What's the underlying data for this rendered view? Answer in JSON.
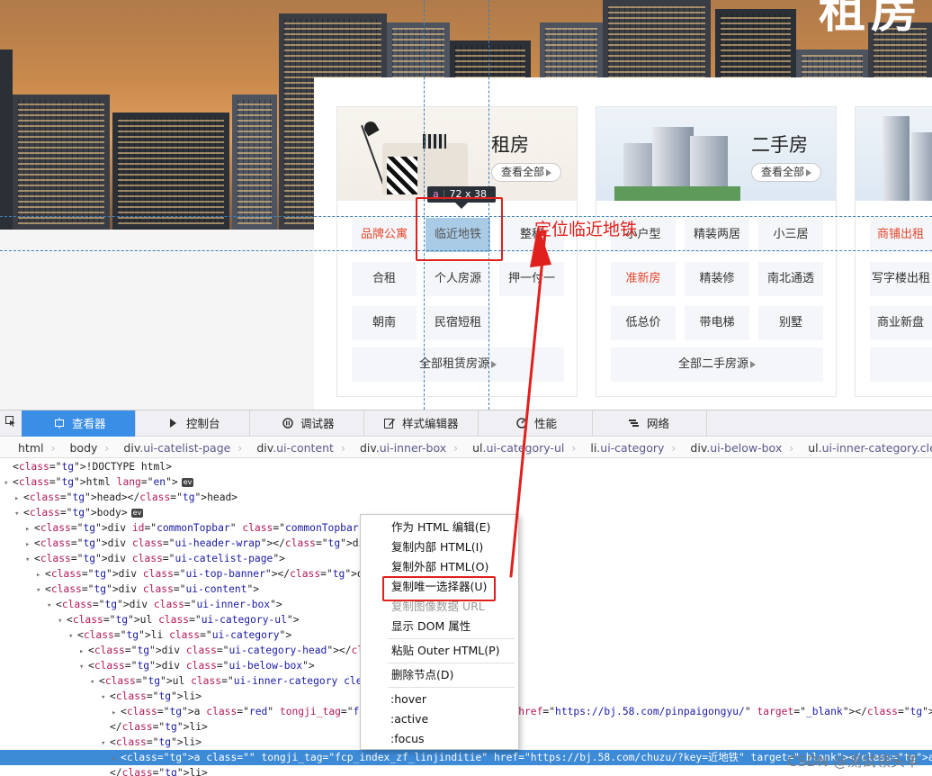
{
  "hero": {
    "title": "租房"
  },
  "cards": [
    {
      "title": "租房",
      "view_all": "查看全部",
      "tags": [
        "品牌公寓",
        "临近地铁",
        "整租",
        "合租",
        "个人房源",
        "押一付一",
        "朝南",
        "民宿短租"
      ],
      "all_link": "全部租赁房源"
    },
    {
      "title": "二手房",
      "view_all": "查看全部",
      "tags": [
        "小户型",
        "精装两居",
        "小三居",
        "准新房",
        "精装修",
        "南北通透",
        "低总价",
        "带电梯",
        "别墅"
      ],
      "all_link": "全部二手房源"
    },
    {
      "tags": [
        "商铺出租",
        "写字楼出租",
        "商业新盘"
      ]
    }
  ],
  "inspector": {
    "tooltip_tag": "a",
    "tooltip_size": "72 x 38",
    "annotation": "定位临近地铁"
  },
  "devtools": {
    "tabs": [
      "查看器",
      "控制台",
      "调试器",
      "样式编辑器",
      "性能",
      "网络"
    ],
    "breadcrumb": [
      {
        "tag": "html",
        "cls": ""
      },
      {
        "tag": "body",
        "cls": ""
      },
      {
        "tag": "div",
        "cls": ".ui-catelist-page"
      },
      {
        "tag": "div",
        "cls": ".ui-content"
      },
      {
        "tag": "div",
        "cls": ".ui-inner-box"
      },
      {
        "tag": "ul",
        "cls": ".ui-category-ul"
      },
      {
        "tag": "li",
        "cls": ".ui-category"
      },
      {
        "tag": "div",
        "cls": ".ui-below-box"
      },
      {
        "tag": "ul",
        "cls": ".ui-inner-category.clearfix"
      }
    ],
    "tree": [
      {
        "indent": 0,
        "tw": "",
        "text": "<!DOCTYPE html>",
        "ev": false,
        "sel": false
      },
      {
        "indent": 0,
        "tw": "▾",
        "text": "<html lang=\"en\">",
        "ev": true,
        "sel": false
      },
      {
        "indent": 1,
        "tw": "▸",
        "text": "<head></head>",
        "ev": false,
        "sel": false
      },
      {
        "indent": 1,
        "tw": "▾",
        "text": "<body>",
        "ev": true,
        "sel": false
      },
      {
        "indent": 2,
        "tw": "▸",
        "text": "<div id=\"commonTopbar\" class=\"commonTopbar\" style=\"mi",
        "ev": false,
        "sel": false
      },
      {
        "indent": 2,
        "tw": "▸",
        "text": "<div class=\"ui-header-wrap\"></div>",
        "ev": false,
        "sel": false
      },
      {
        "indent": 2,
        "tw": "▾",
        "text": "<div class=\"ui-catelist-page\">",
        "ev": false,
        "sel": false
      },
      {
        "indent": 3,
        "tw": "▸",
        "text": "<div class=\"ui-top-banner\"></div>",
        "ev": false,
        "sel": false
      },
      {
        "indent": 3,
        "tw": "▾",
        "text": "<div class=\"ui-content\">",
        "ev": false,
        "sel": false
      },
      {
        "indent": 4,
        "tw": "▾",
        "text": "<div class=\"ui-inner-box\">",
        "ev": false,
        "sel": false
      },
      {
        "indent": 5,
        "tw": "▾",
        "text": "<ul class=\"ui-category-ul\">",
        "ev": false,
        "sel": false
      },
      {
        "indent": 6,
        "tw": "▾",
        "text": "<li class=\"ui-category\">",
        "ev": false,
        "sel": false
      },
      {
        "indent": 7,
        "tw": "▸",
        "text": "<div class=\"ui-category-head\"></div>",
        "ev": false,
        "sel": false
      },
      {
        "indent": 7,
        "tw": "▾",
        "text": "<div class=\"ui-below-box\">",
        "ev": false,
        "sel": false
      },
      {
        "indent": 8,
        "tw": "▾",
        "text": "<ul class=\"ui-inner-category clearfix\">",
        "ev": false,
        "sel": false
      },
      {
        "indent": 9,
        "tw": "▾",
        "text": "<li>",
        "ev": false,
        "sel": false
      },
      {
        "indent": 10,
        "tw": "▸",
        "text": "<a class=\"red\" tongji_tag=\"fcp_index_zf_pinpaigongyu\" href=\"https://bj.58.com/pinpaigongyu/\" target=\"_blank\"></a>",
        "ev": true,
        "sel": false
      },
      {
        "indent": 9,
        "tw": "",
        "text": "</li>",
        "ev": false,
        "sel": false
      },
      {
        "indent": 9,
        "tw": "▾",
        "text": "<li>",
        "ev": false,
        "sel": false
      },
      {
        "indent": 10,
        "tw": "▸",
        "text": "<a class=\"\" tongji_tag=\"fcp_index_zf_linjinditie\" href=\"https://bj.58.com/chuzu/?key=近地铁\" target=\"_blank\"></a>",
        "ev": true,
        "sel": true
      },
      {
        "indent": 9,
        "tw": "",
        "text": "</li>",
        "ev": false,
        "sel": false
      }
    ],
    "context_menu": [
      {
        "label": "作为 HTML 编辑(E)",
        "disabled": false
      },
      {
        "label": "复制内部 HTML(I)",
        "disabled": false
      },
      {
        "label": "复制外部 HTML(O)",
        "disabled": false
      },
      {
        "label": "复制唯一选择器(U)",
        "disabled": false
      },
      {
        "label": "复制图像数据 URL",
        "disabled": true
      },
      {
        "label": "显示 DOM 属性",
        "disabled": false
      },
      {
        "label": "粘贴 Outer HTML(P)",
        "disabled": false
      },
      {
        "label": "删除节点(D)",
        "disabled": false
      },
      {
        "label": ":hover",
        "disabled": false
      },
      {
        "label": ":active",
        "disabled": false
      },
      {
        "label": ":focus",
        "disabled": false
      }
    ]
  },
  "watermark": "CSDN @测试领头羊",
  "colors": {
    "accent": "#3a8ee6",
    "annotation_red": "#e0201c",
    "tag_red": "#e4472c"
  }
}
